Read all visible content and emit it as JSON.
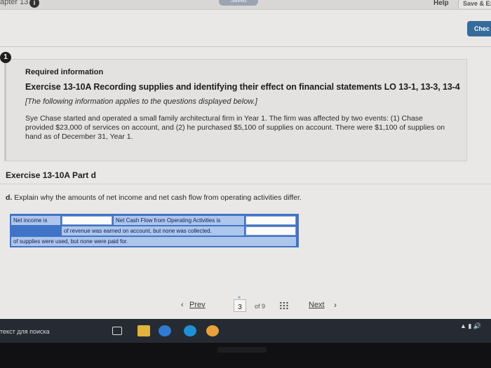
{
  "topbar": {
    "chapter": "apter 13",
    "chapter_badge": "i",
    "saved": "Saved",
    "help": "Help",
    "save_exit": "Save & Ex"
  },
  "check_button": "Chec",
  "question_number": "1",
  "info": {
    "required": "Required information",
    "exercise_title": "Exercise 13-10A Recording supplies and identifying their effect on financial statements LO 13-1, 13-3, 13-4",
    "note": "[The following information applies to the questions displayed below.]",
    "description": "Sye Chase started and operated a small family architectural firm in Year 1. The firm was affected by two events: (1) Chase provided $23,000 of services on account, and (2) he purchased $5,100 of supplies on account. There were $1,100 of supplies on hand as of December 31, Year 1."
  },
  "part": {
    "title": "Exercise 13-10A Part d",
    "question_prefix": "d.",
    "question": "Explain why the amounts of net income and net cash flow from operating activities differ."
  },
  "answer": {
    "label_net_income": "Net income is",
    "label_net_cash": "Net Cash Flow from Operating Activities is",
    "label_revenue": "of revenue was earned on account, but none was collected.",
    "label_supplies": "of supplies were used, but none were paid for.",
    "input_net_income": "",
    "input_net_cash": "",
    "input_revenue": ""
  },
  "pager": {
    "prev": "Prev",
    "current_page": "3",
    "of": "of 9",
    "next": "Next"
  },
  "taskbar": {
    "search_placeholder": "текст для поиска"
  }
}
